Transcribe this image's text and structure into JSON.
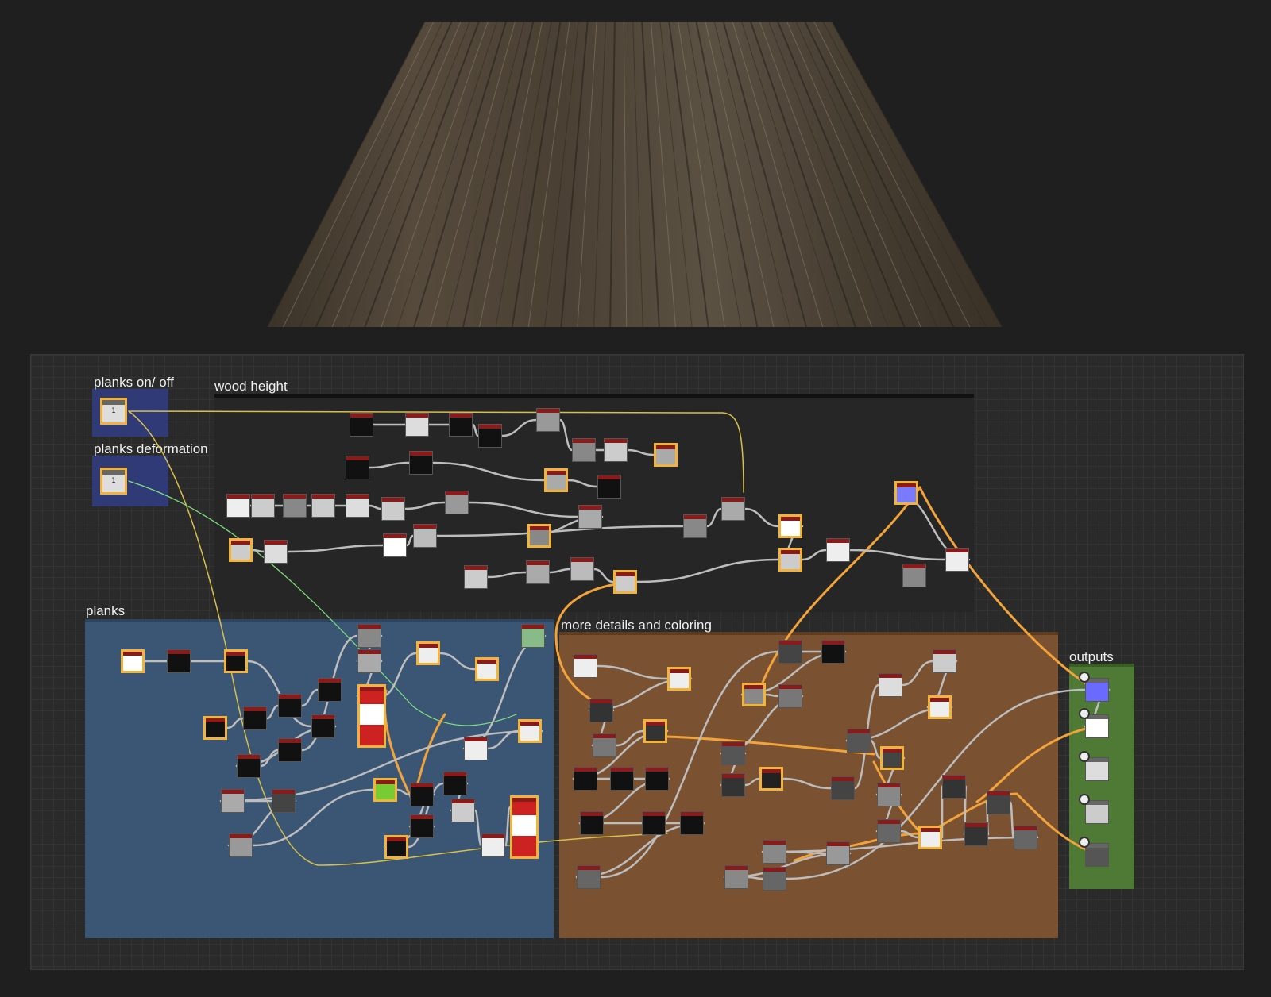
{
  "frames": {
    "planks_on_off": "planks on/ off",
    "planks_deformation": "planks deformation",
    "wood_height": "wood height",
    "planks": "planks",
    "more_details": "more details and coloring",
    "outputs": "outputs"
  },
  "params": {
    "planks_on_off_value": "1",
    "planks_deformation_value": "1"
  },
  "colors": {
    "canvas": "#2a2a2a",
    "planks_frame": "#3b5674",
    "details_frame": "#7a5232",
    "outputs_frame": "#4e7a36",
    "param_frame": "#2f3b7a",
    "wood_height_frame": "#262626",
    "selection": "#f2b33a",
    "node_header": "#8b1a1a"
  },
  "icons": [
    "output-pin-icon"
  ]
}
